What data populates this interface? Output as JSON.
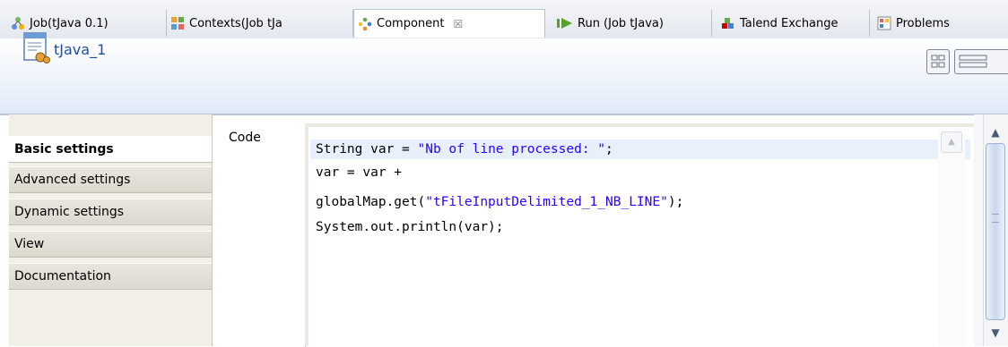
{
  "tabs": [
    {
      "label": "Job(tJava 0.1)",
      "icon": "job-icon"
    },
    {
      "label": "Contexts(Job tJa",
      "icon": "contexts-icon"
    },
    {
      "label": "Component",
      "icon": "component-icon",
      "active": true,
      "close": "☒"
    },
    {
      "label": "Run (Job tJava)",
      "icon": "run-icon"
    },
    {
      "label": "Talend Exchange",
      "icon": "exchange-icon"
    },
    {
      "label": "Problems",
      "icon": "problems-icon"
    }
  ],
  "header": {
    "title": "tJava_1",
    "icon": "tjava-component-icon"
  },
  "sidebar": {
    "items": [
      {
        "label": "Basic settings",
        "active": true
      },
      {
        "label": "Advanced settings"
      },
      {
        "label": "Dynamic settings"
      },
      {
        "label": "View"
      },
      {
        "label": "Documentation"
      }
    ]
  },
  "main": {
    "code_label": "Code",
    "code": {
      "line1_a": "String var = ",
      "line1_b": "\"Nb of line processed: \"",
      "line1_c": ";",
      "line2": "var = var +",
      "line3_a": "globalMap.get(",
      "line3_b": "\"tFileInputDelimited_1_NB_LINE\"",
      "line3_c": ");",
      "line4": "System.out.println(var);"
    }
  },
  "colors": {
    "string_literal": "#2a00ff",
    "header_title": "#1f4f96",
    "active_line": "#e8f0fb"
  }
}
